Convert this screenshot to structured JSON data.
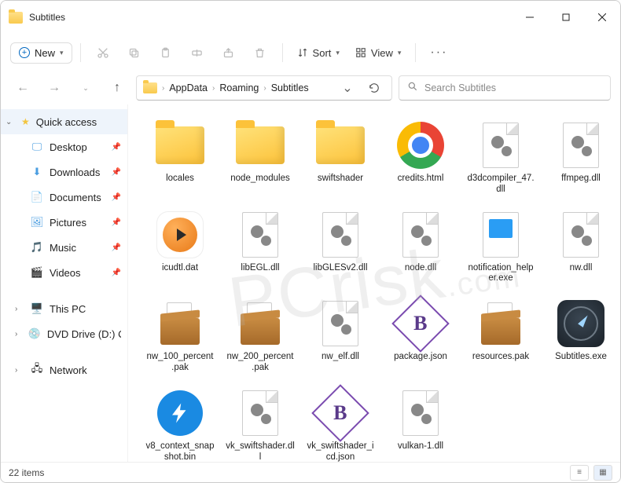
{
  "window": {
    "title": "Subtitles"
  },
  "toolbar": {
    "new_label": "New",
    "sort_label": "Sort",
    "view_label": "View"
  },
  "breadcrumbs": [
    "AppData",
    "Roaming",
    "Subtitles"
  ],
  "search": {
    "placeholder": "Search Subtitles"
  },
  "sidebar": {
    "quick_access": "Quick access",
    "items": [
      {
        "label": "Desktop",
        "icon": "desktop",
        "pinned": true
      },
      {
        "label": "Downloads",
        "icon": "downloads",
        "pinned": true
      },
      {
        "label": "Documents",
        "icon": "documents",
        "pinned": true
      },
      {
        "label": "Pictures",
        "icon": "pictures",
        "pinned": true
      },
      {
        "label": "Music",
        "icon": "music",
        "pinned": true
      },
      {
        "label": "Videos",
        "icon": "videos",
        "pinned": true
      }
    ],
    "this_pc": "This PC",
    "dvd": "DVD Drive (D:) CCCC",
    "network": "Network"
  },
  "files": [
    {
      "name": "locales",
      "type": "folder"
    },
    {
      "name": "node_modules",
      "type": "folder"
    },
    {
      "name": "swiftshader",
      "type": "folder"
    },
    {
      "name": "credits.html",
      "type": "chrome"
    },
    {
      "name": "d3dcompiler_47.dll",
      "type": "dll"
    },
    {
      "name": "ffmpeg.dll",
      "type": "dll"
    },
    {
      "name": "icudtl.dat",
      "type": "dat"
    },
    {
      "name": "libEGL.dll",
      "type": "dll"
    },
    {
      "name": "libGLESv2.dll",
      "type": "dll"
    },
    {
      "name": "node.dll",
      "type": "dll"
    },
    {
      "name": "notification_helper.exe",
      "type": "notif"
    },
    {
      "name": "nw.dll",
      "type": "dll"
    },
    {
      "name": "nw_100_percent.pak",
      "type": "pak"
    },
    {
      "name": "nw_200_percent.pak",
      "type": "pak"
    },
    {
      "name": "nw_elf.dll",
      "type": "dll"
    },
    {
      "name": "package.json",
      "type": "json"
    },
    {
      "name": "resources.pak",
      "type": "pak"
    },
    {
      "name": "Subtitles.exe",
      "type": "compass"
    },
    {
      "name": "v8_context_snapshot.bin",
      "type": "bolt"
    },
    {
      "name": "vk_swiftshader.dll",
      "type": "dll"
    },
    {
      "name": "vk_swiftshader_icd.json",
      "type": "json"
    },
    {
      "name": "vulkan-1.dll",
      "type": "dll"
    }
  ],
  "status": {
    "items": "22 items"
  }
}
